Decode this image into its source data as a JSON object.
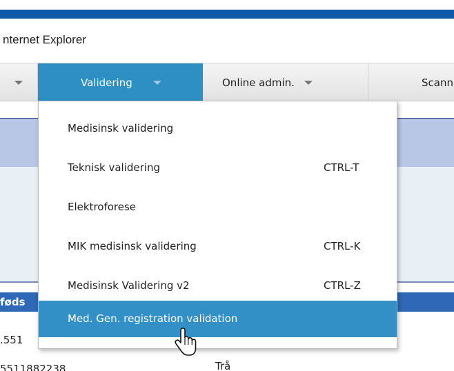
{
  "window": {
    "title": "nternet Explorer"
  },
  "menubar": {
    "active": "Validering",
    "items": [
      {
        "label": "Validering"
      },
      {
        "label": "Online admin."
      },
      {
        "label": "Scann"
      }
    ]
  },
  "dropdown": {
    "items": [
      {
        "label": "Medisinsk validering",
        "shortcut": ""
      },
      {
        "label": "Teknisk validering",
        "shortcut": "CTRL-T"
      },
      {
        "label": "Elektroforese",
        "shortcut": ""
      },
      {
        "label": "MIK medisinsk validering",
        "shortcut": "CTRL-K"
      },
      {
        "label": "Medisinsk Validering v2",
        "shortcut": "CTRL-Z"
      },
      {
        "label": "Med. Gen. registration validation",
        "shortcut": ""
      }
    ],
    "hovered_index": 5
  },
  "background": {
    "header_partial": "føds",
    "row1_partial": ".551",
    "row2_partial": "5511882238",
    "row2_extra": "Trå"
  },
  "colors": {
    "accent": "#2e8fc4",
    "title_strip": "#0f5aa8",
    "table_header": "#2f68b6",
    "hover": "#3390c6"
  },
  "icons": {
    "cursor": "hand-pointer-icon",
    "menu_arrow": "chevron-down-icon"
  }
}
